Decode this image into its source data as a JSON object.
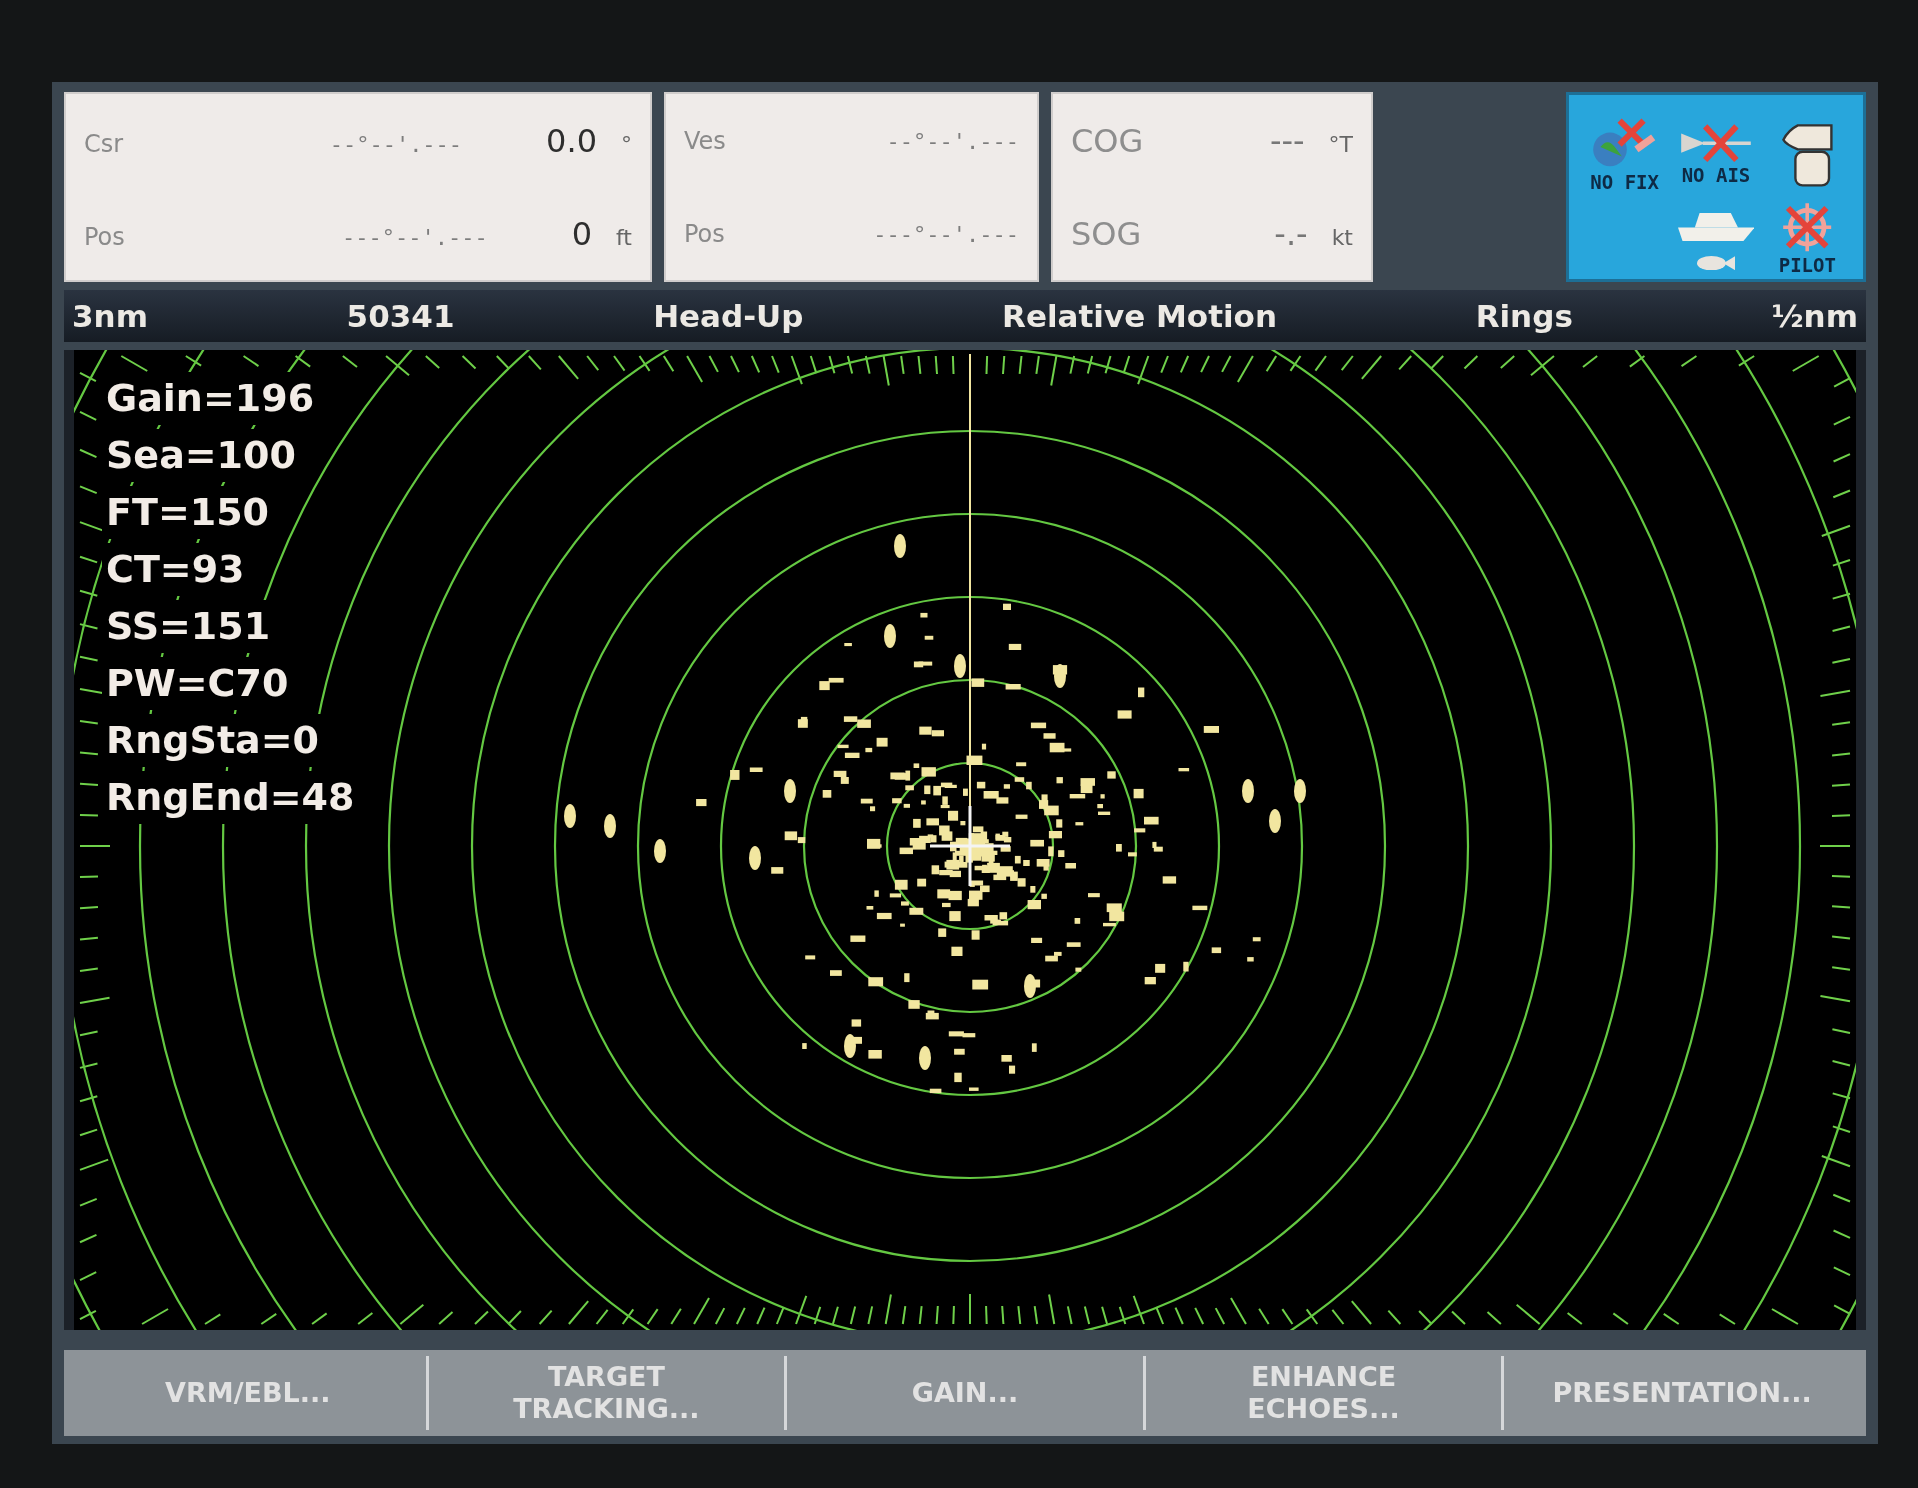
{
  "data_boxes": [
    {
      "rows": [
        {
          "label": "Csr",
          "position": "--°--'.---",
          "value": "0.0",
          "unit": "°"
        },
        {
          "label": "Pos",
          "position": "---°--'.---",
          "value": "0",
          "unit": "ft"
        }
      ]
    },
    {
      "rows": [
        {
          "label": "Ves",
          "position": "--°--'.---"
        },
        {
          "label": "Pos",
          "position": "---°--'.---"
        }
      ]
    },
    {
      "rows": [
        {
          "label": "COG",
          "value": "---",
          "unit": "°T"
        },
        {
          "label": "SOG",
          "value": "-.-",
          "unit": "kt"
        }
      ]
    }
  ],
  "status_panel": {
    "items": [
      {
        "kind": "fix",
        "label": "NO FIX"
      },
      {
        "kind": "ais",
        "label": "NO AIS"
      },
      {
        "kind": "hand"
      },
      {
        "kind": "boat"
      },
      {
        "kind": "fish"
      },
      {
        "kind": "pilot",
        "label": "PILOT"
      }
    ]
  },
  "mode_bar": [
    "3nm",
    "50341",
    "Head-Up",
    "Relative Motion",
    "Rings",
    "½nm"
  ],
  "radar": {
    "parameters": [
      "Gain=196",
      "Sea=100",
      "FT=150",
      "CT=93",
      "SS=151",
      "PW=C70",
      "RngSta=0",
      "RngEnd=48"
    ]
  },
  "soft_keys": [
    {
      "lines": [
        "VRM/EBL..."
      ]
    },
    {
      "lines": [
        "TARGET",
        "TRACKING..."
      ]
    },
    {
      "lines": [
        "GAIN..."
      ]
    },
    {
      "lines": [
        "ENHANCE",
        "ECHOES..."
      ]
    },
    {
      "lines": [
        "PRESENTATION..."
      ]
    }
  ]
}
